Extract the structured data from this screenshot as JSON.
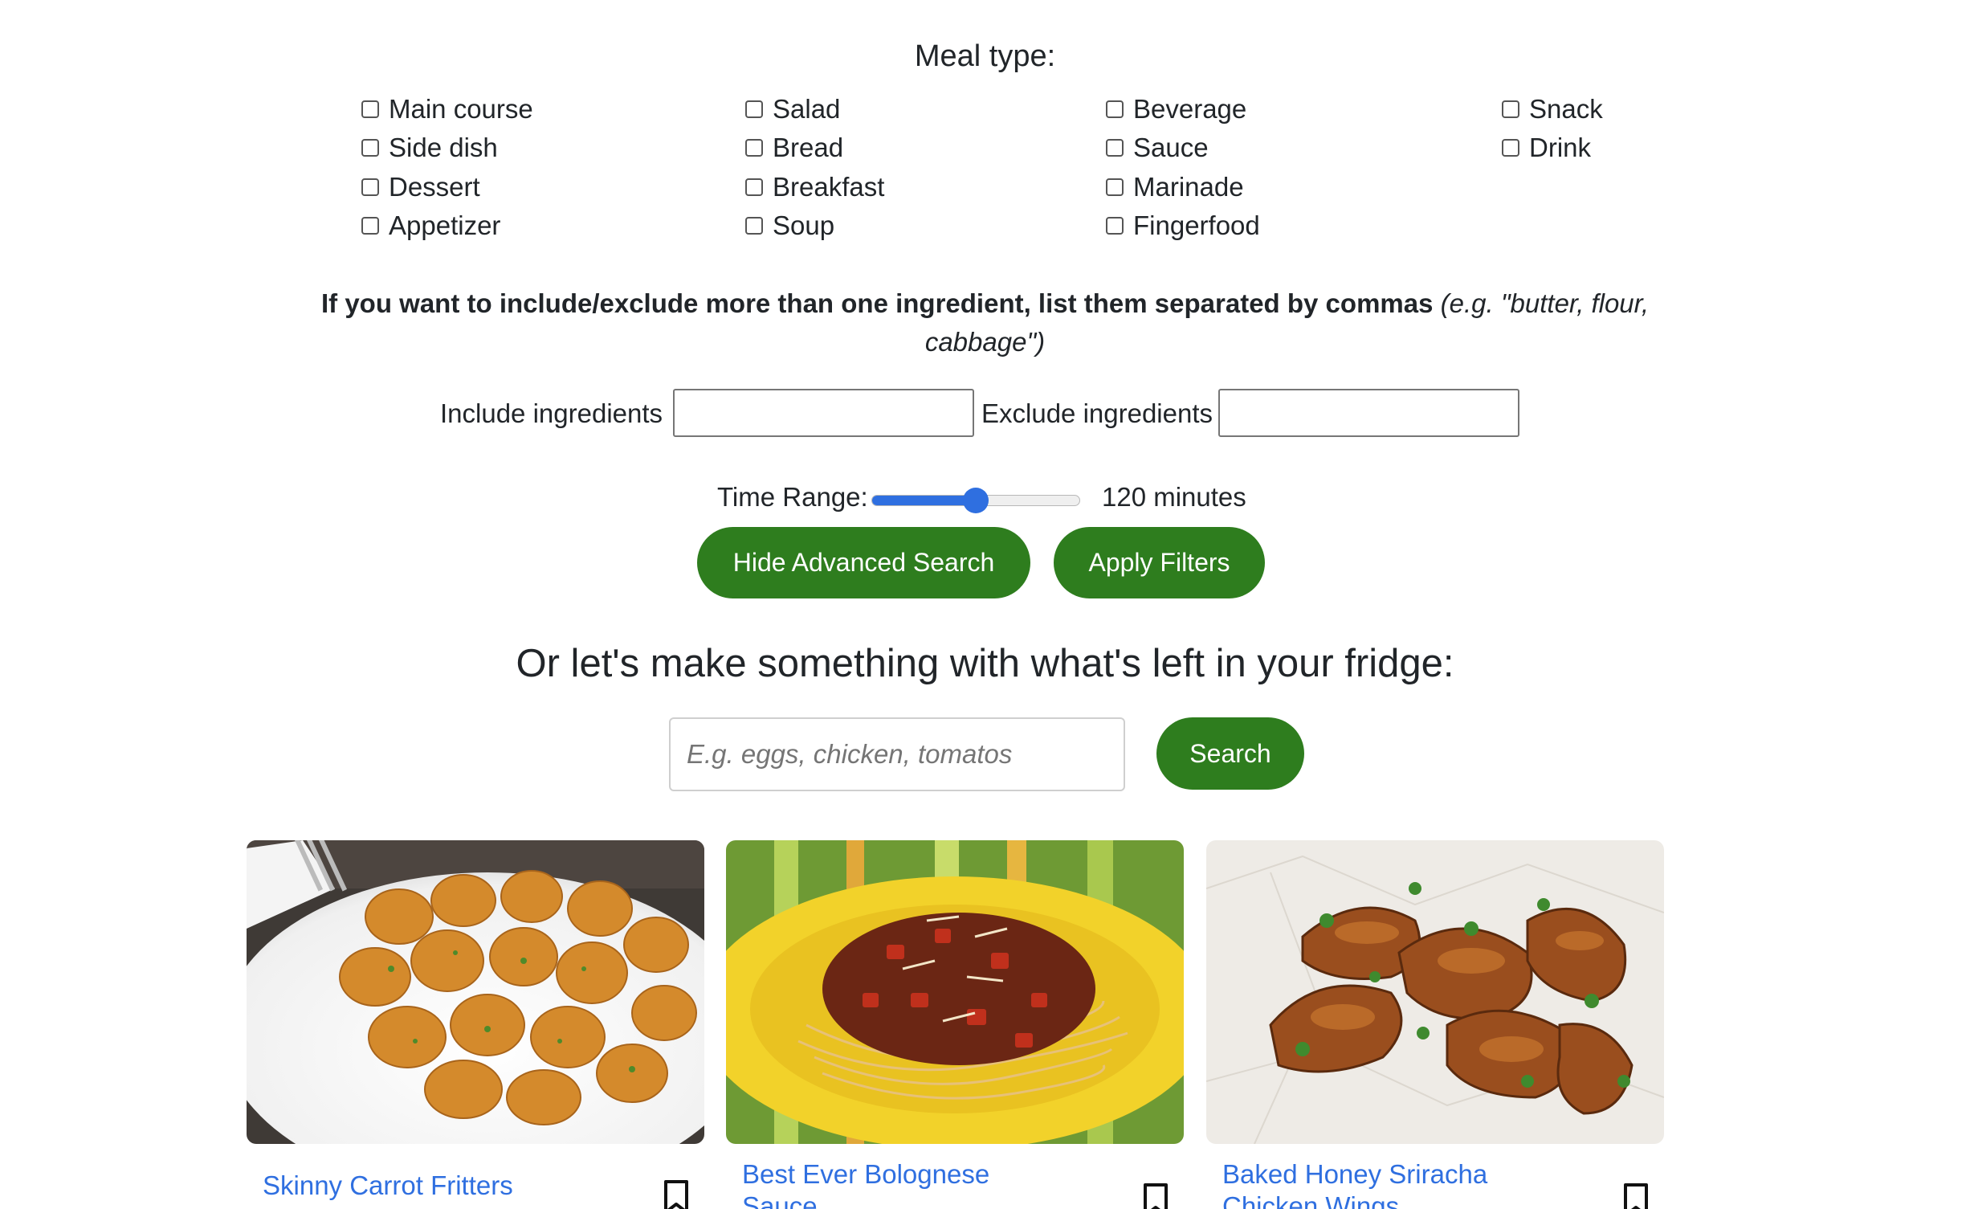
{
  "meal_type": {
    "title": "Meal type:",
    "columns": [
      [
        "Main course",
        "Side dish",
        "Dessert",
        "Appetizer"
      ],
      [
        "Salad",
        "Bread",
        "Breakfast",
        "Soup"
      ],
      [
        "Beverage",
        "Sauce",
        "Marinade",
        "Fingerfood"
      ],
      [
        "Snack",
        "Drink"
      ]
    ]
  },
  "ingredients": {
    "note_bold": "If you want to include/exclude more than one ingredient, list them separated by commas",
    "note_italic": "(e.g. \"butter, flour, cabbage\")",
    "include_label": "Include ingredients",
    "exclude_label": "Exclude ingredients",
    "include_value": "",
    "exclude_value": ""
  },
  "time_range": {
    "label": "Time Range:",
    "value_text": "120 minutes",
    "level_fraction": 0.5,
    "accent_color": "#2f6fe0"
  },
  "buttons": {
    "hide_advanced": "Hide Advanced Search",
    "apply_filters": "Apply Filters",
    "search": "Search",
    "color": "#2e7d1e"
  },
  "fridge": {
    "title": "Or let's make something with what's left in your fridge:",
    "placeholder": "E.g. eggs, chicken, tomatos",
    "value": ""
  },
  "recipes": [
    {
      "title": "Skinny Carrot Fritters",
      "image": "carrot-fritters-photo",
      "bookmark_icon": "bookmark-icon"
    },
    {
      "title": "Best Ever Bolognese Sauce",
      "image": "spaghetti-bolognese-photo",
      "bookmark_icon": "bookmark-icon"
    },
    {
      "title": "Baked Honey Sriracha Chicken Wings",
      "image": "chicken-wings-photo",
      "bookmark_icon": "bookmark-icon"
    }
  ],
  "link_color": "#2f6fe0"
}
